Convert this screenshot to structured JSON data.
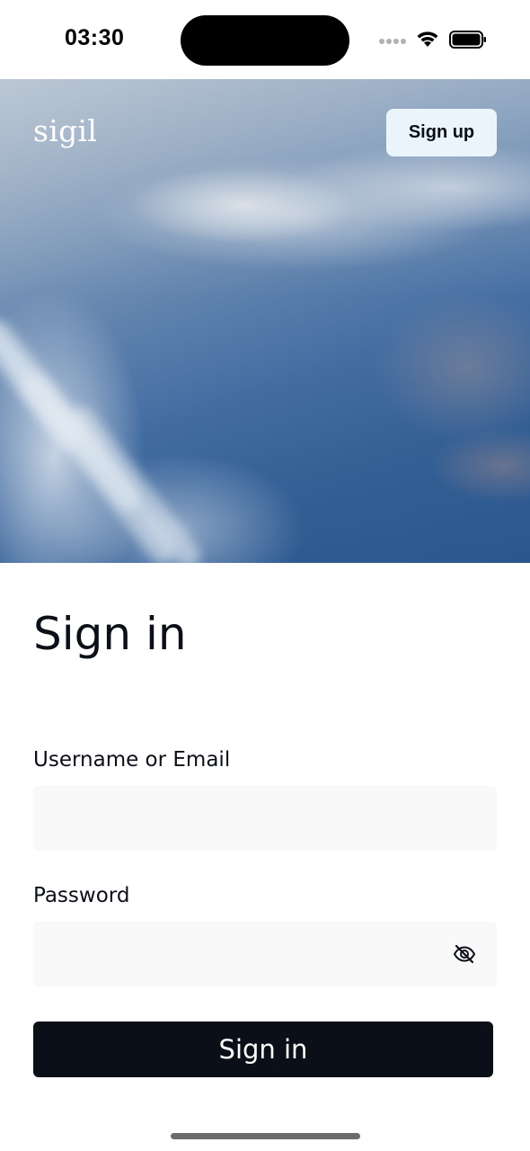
{
  "status_bar": {
    "time": "03:30",
    "icons": [
      "signal-icon",
      "wifi-icon",
      "battery-icon"
    ]
  },
  "header": {
    "brand": "sigil",
    "signup_label": "Sign up"
  },
  "hero": {
    "image": "aerial-landscape-clouds"
  },
  "form": {
    "title": "Sign in",
    "username_label": "Username or Email",
    "username_value": "",
    "username_placeholder": "",
    "password_label": "Password",
    "password_value": "",
    "password_placeholder": "",
    "visibility_icon": "eye-slash-icon",
    "submit_label": "Sign in"
  },
  "colors": {
    "primary": "#0b0f17",
    "signup_bg": "#eaf4fb",
    "input_bg": "#f9f9f9"
  }
}
